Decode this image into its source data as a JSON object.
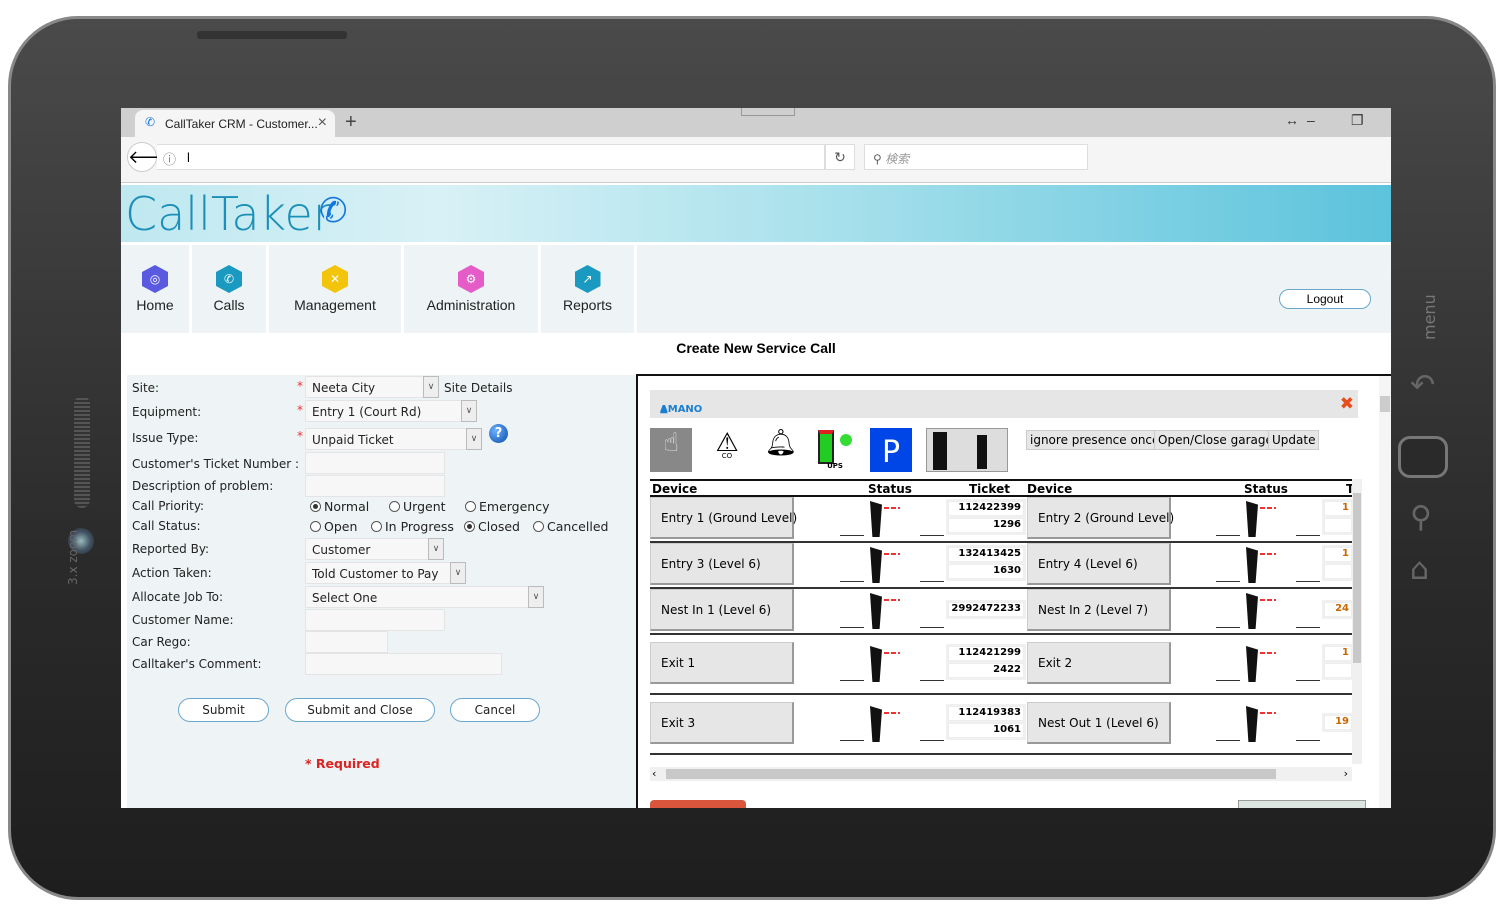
{
  "device": {
    "side_label": "3.x zoom",
    "menu_label": "menu"
  },
  "browser": {
    "tab_title": "CallTaker CRM - Customer...",
    "url": "l",
    "search_placeholder": "検索"
  },
  "app": {
    "logo": "CallTaker",
    "brand_color": "#1b8fb8"
  },
  "nav": {
    "items": [
      {
        "label": "Home",
        "icon": "globe-icon",
        "color": "#5a5ae0"
      },
      {
        "label": "Calls",
        "icon": "phone-icon",
        "color": "#1a9ac0"
      },
      {
        "label": "Management",
        "icon": "tools-icon",
        "color": "#f2c40a"
      },
      {
        "label": "Administration",
        "icon": "gear-icon",
        "color": "#e55cc8"
      },
      {
        "label": "Reports",
        "icon": "chart-icon",
        "color": "#1a9ac0"
      }
    ],
    "logout": "Logout"
  },
  "page_title": "Create New Service Call",
  "form": {
    "site": {
      "label": "Site:",
      "value": "Neeta City",
      "link": "Site Details"
    },
    "equipment": {
      "label": "Equipment:",
      "value": "Entry 1 (Court Rd)"
    },
    "issue_type": {
      "label": "Issue Type:",
      "value": "Unpaid Ticket"
    },
    "ticket_number": {
      "label": "Customer's Ticket Number :",
      "value": ""
    },
    "description": {
      "label": "Description of problem:",
      "value": ""
    },
    "priority": {
      "label": "Call Priority:",
      "options": [
        "Normal",
        "Urgent",
        "Emergency"
      ],
      "selected": "Normal"
    },
    "status": {
      "label": "Call Status:",
      "options": [
        "Open",
        "In Progress",
        "Closed",
        "Cancelled"
      ],
      "selected": "Closed"
    },
    "reported_by": {
      "label": "Reported By:",
      "value": "Customer"
    },
    "action_taken": {
      "label": "Action Taken:",
      "value": "Told Customer to Pay"
    },
    "allocate": {
      "label": "Allocate Job To:",
      "value": "Select One"
    },
    "customer_name": {
      "label": "Customer Name:",
      "value": ""
    },
    "car_rego": {
      "label": "Car Rego:",
      "value": ""
    },
    "comment": {
      "label": "Calltaker's Comment:",
      "value": ""
    },
    "required_mark": "*",
    "required_note": "* Required",
    "buttons": {
      "submit": "Submit",
      "submit_close": "Submit and Close",
      "cancel": "Cancel"
    }
  },
  "panel": {
    "brand": "AMANO",
    "status_icons": {
      "co_label": "CO",
      "ups_label": "UPS"
    },
    "buttons": [
      "ignore presence once",
      "Open/Close garage",
      "Update"
    ],
    "headers": [
      "Device",
      "Status",
      "Ticket",
      "Device",
      "Status",
      "T"
    ],
    "rows": [
      {
        "left": "Entry 1 (Ground Level)",
        "tickets": [
          "112422399",
          "1296"
        ],
        "right": "Entry 2 (Ground Level)",
        "rtickets": [
          "1",
          ""
        ]
      },
      {
        "left": "Entry 3 (Level 6)",
        "tickets": [
          "132413425",
          "1630"
        ],
        "right": "Entry 4 (Level 6)",
        "rtickets": [
          "1",
          ""
        ]
      },
      {
        "left": "Nest In 1 (Level 6)",
        "tickets": [
          "2992472233"
        ],
        "right": "Nest In 2 (Level 7)",
        "rtickets": [
          "24"
        ]
      },
      {
        "left": "Exit 1",
        "tickets": [
          "112421299",
          "2422"
        ],
        "right": "Exit 2",
        "rtickets": [
          "1",
          ""
        ]
      },
      {
        "left": "Exit 3",
        "tickets": [
          "112419383",
          "1061"
        ],
        "right": "Nest Out 1 (Level 6)",
        "rtickets": [
          "19"
        ]
      }
    ]
  }
}
